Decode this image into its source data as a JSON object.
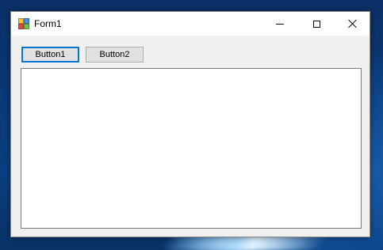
{
  "window": {
    "title": "Form1",
    "controls": {
      "minimize_icon": "minimize-icon",
      "maximize_icon": "maximize-icon",
      "close_icon": "close-icon"
    }
  },
  "form": {
    "button1_label": "Button1",
    "button2_label": "Button2",
    "textbox_value": ""
  },
  "colors": {
    "focus_accent": "#0078d7",
    "button_face": "#e1e1e1",
    "form_background": "#f0f0f0",
    "titlebar_background": "#ffffff"
  }
}
